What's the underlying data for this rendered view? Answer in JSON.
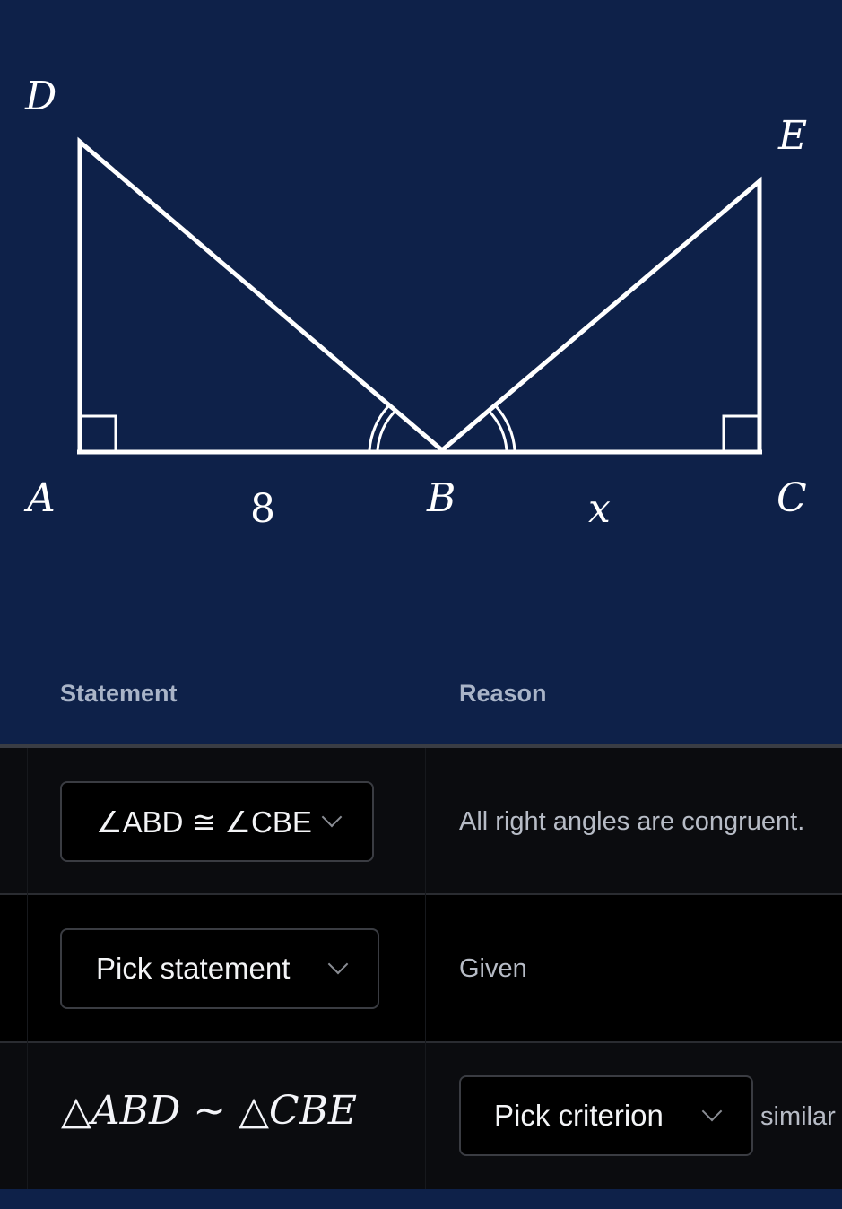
{
  "diagram": {
    "points": {
      "A": "A",
      "B": "B",
      "C": "C",
      "D": "D",
      "E": "E"
    },
    "segment_labels": {
      "AB": "8",
      "BC": "x"
    },
    "marks": [
      "right-angle at A",
      "right-angle at C",
      "double arc at angle ABD",
      "double arc at angle CBE"
    ],
    "colors": {
      "background": "#0e2149",
      "lines": "#ffffff"
    }
  },
  "table": {
    "headers": {
      "statement": "Statement",
      "reason": "Reason"
    },
    "rows": [
      {
        "statement_dropdown": "∠ABD ≅ ∠CBE",
        "reason": "All right angles are congruent."
      },
      {
        "statement_dropdown": "Pick statement",
        "reason": "Given"
      },
      {
        "statement": {
          "left": "△",
          "l1": "ABD",
          "op": " ∼ ",
          "right": "△",
          "l2": "CBE"
        },
        "reason_dropdown": "Pick criterion",
        "reason_suffix": "similar"
      }
    ]
  }
}
